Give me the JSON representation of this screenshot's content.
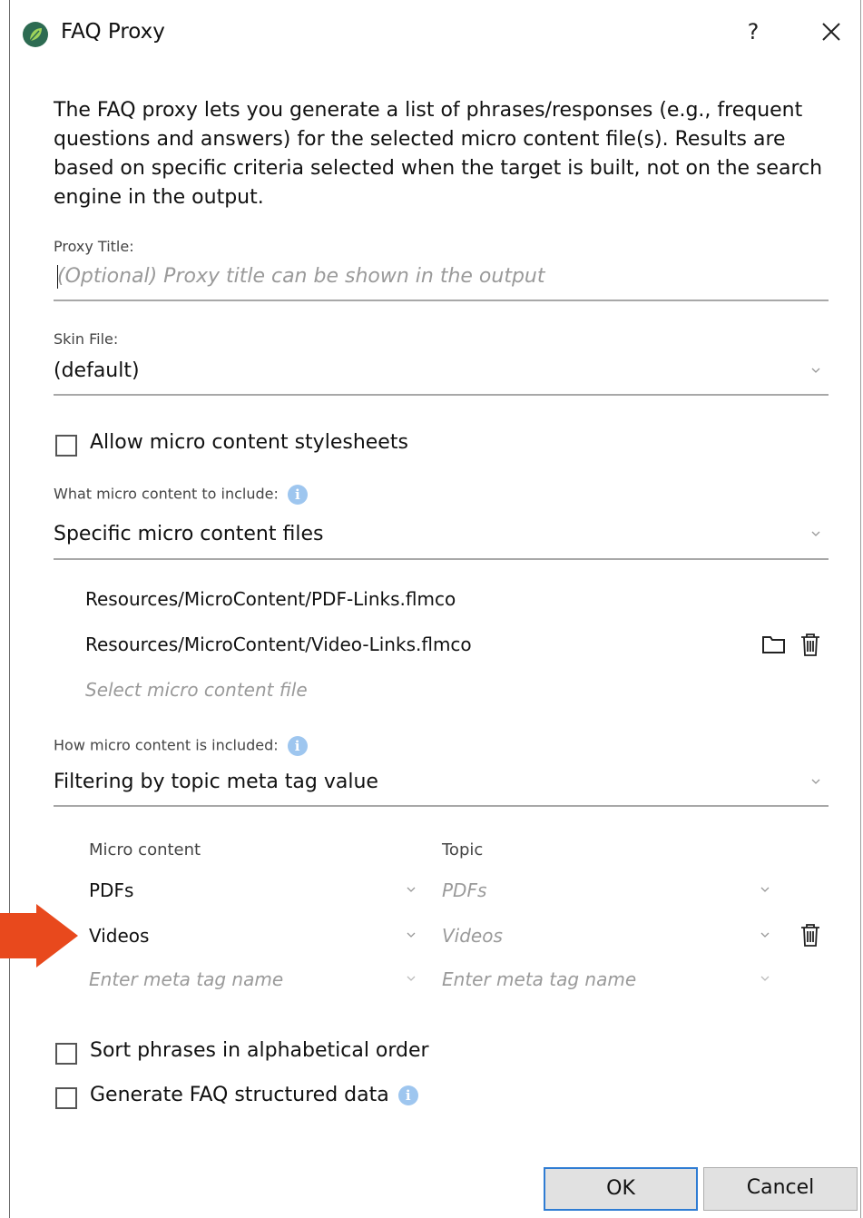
{
  "window": {
    "title": "FAQ Proxy",
    "help_label": "?"
  },
  "description": "The FAQ proxy lets you generate a list of phrases/responses (e.g., frequent questions and answers) for the selected micro content file(s). Results are based on specific criteria selected when the target is built, not on the search engine in the output.",
  "proxy_title": {
    "label": "Proxy Title:",
    "placeholder": "(Optional) Proxy title can be shown in the output"
  },
  "skin_file": {
    "label": "Skin File:",
    "value": "(default)"
  },
  "allow_stylesheets": {
    "label": "Allow micro content stylesheets",
    "checked": false
  },
  "what_content": {
    "label": "What micro content to include:",
    "value": "Specific micro content files"
  },
  "files": {
    "items": [
      "Resources/MicroContent/PDF-Links.flmco",
      "Resources/MicroContent/Video-Links.flmco"
    ],
    "placeholder": "Select micro content file"
  },
  "how_content": {
    "label": "How micro content is included:",
    "value": "Filtering by topic meta tag value"
  },
  "mapping": {
    "headers": [
      "Micro content",
      "Topic"
    ],
    "rows": [
      {
        "micro": "PDFs",
        "topic": "PDFs"
      },
      {
        "micro": "Videos",
        "topic": "Videos"
      }
    ],
    "placeholder_micro": "Enter meta tag name",
    "placeholder_topic": "Enter meta tag name"
  },
  "sort_alpha": {
    "label": "Sort phrases in alphabetical order",
    "checked": false
  },
  "faq_structured": {
    "label": "Generate FAQ structured data",
    "checked": false
  },
  "buttons": {
    "ok": "OK",
    "cancel": "Cancel"
  },
  "colors": {
    "accent": "#2f7cd3",
    "info": "#9ec6ef",
    "arrow": "#e8491d",
    "app_icon": "#2d6b52"
  }
}
